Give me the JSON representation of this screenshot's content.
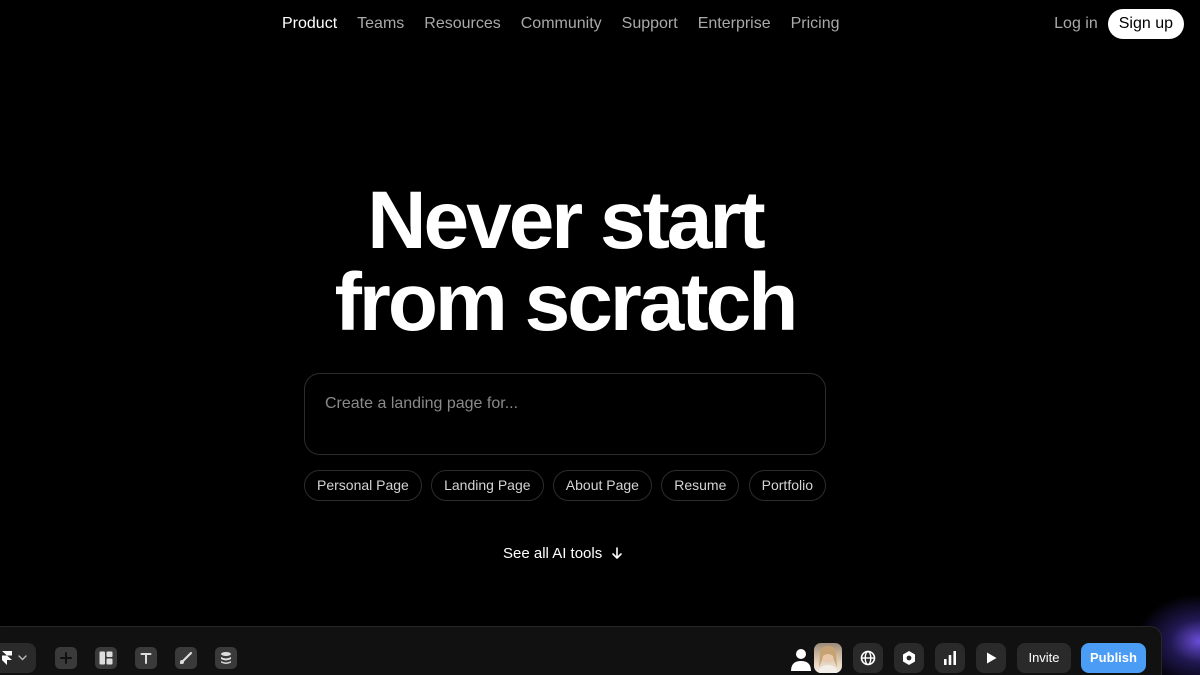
{
  "nav": {
    "items": [
      {
        "label": "Product",
        "active": true
      },
      {
        "label": "Teams"
      },
      {
        "label": "Resources"
      },
      {
        "label": "Community"
      },
      {
        "label": "Support"
      },
      {
        "label": "Enterprise"
      },
      {
        "label": "Pricing"
      }
    ],
    "login_label": "Log in",
    "signup_label": "Sign up"
  },
  "hero": {
    "title_line1": "Never start",
    "title_line2": "from scratch",
    "prompt_placeholder": "Create a landing page for...",
    "chips": [
      "Personal Page",
      "Landing Page",
      "About Page",
      "Resume",
      "Portfolio"
    ],
    "see_all_label": "See all AI tools"
  },
  "toolbar": {
    "left_tools": [
      "insert-icon",
      "layout-icon",
      "text-icon",
      "vector-icon",
      "cms-icon"
    ],
    "right_tools": [
      "globe-icon",
      "settings-icon",
      "analytics-icon",
      "preview-icon"
    ],
    "invite_label": "Invite",
    "publish_label": "Publish"
  },
  "colors": {
    "background": "#000000",
    "accent_publish": "#4a9cf5",
    "muted_text": "#a9a9a9",
    "glow": "#7c5cff"
  }
}
